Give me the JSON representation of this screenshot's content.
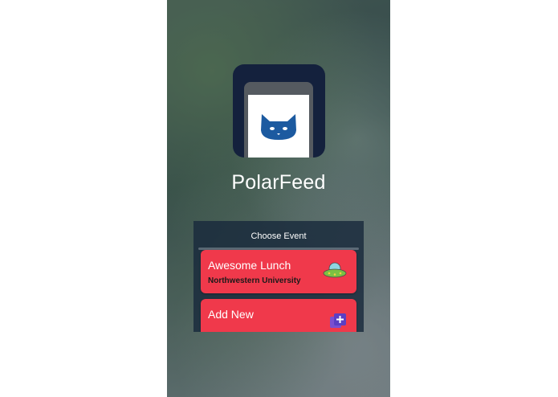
{
  "app": {
    "name": "PolarFeed"
  },
  "event_panel": {
    "title": "Choose Event",
    "events": [
      {
        "name": "Awesome Lunch",
        "place": "Northwestern University",
        "icon": "ufo-icon"
      },
      {
        "name": "Add New",
        "icon": "add-icon"
      }
    ]
  },
  "colors": {
    "card": "#f0394b",
    "icon_bg": "#14213d",
    "cat": "#1c5aa0"
  }
}
